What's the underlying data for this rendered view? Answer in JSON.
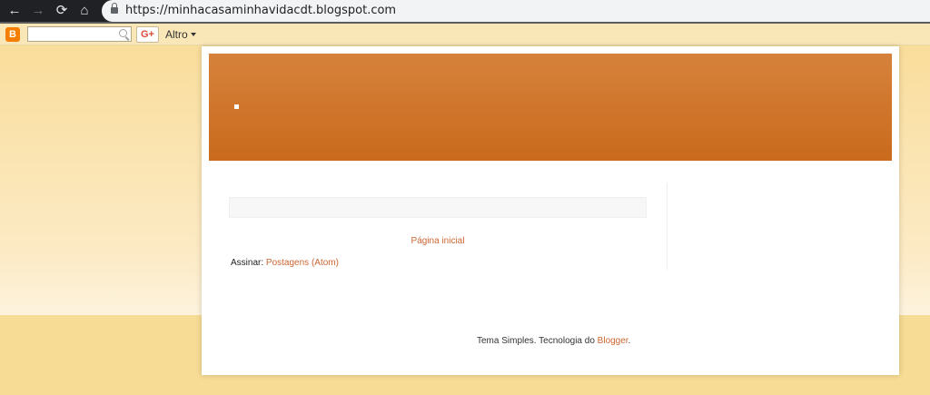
{
  "browser": {
    "back_icon": "←",
    "forward_icon": "→",
    "reload_icon": "⟳",
    "home_icon": "⌂",
    "url": "https://minhacasaminhavidacdt.blogspot.com"
  },
  "navbar": {
    "logo_glyph": "B",
    "gplus_label": "G+",
    "more_label": "Altro"
  },
  "blog": {
    "home_link": "Página inicial",
    "subscribe_label": "Assinar: ",
    "subscribe_link": "Postagens (Atom)",
    "footer_text": "Tema Simples. Tecnologia do ",
    "footer_link": "Blogger",
    "footer_end": "."
  },
  "colors": {
    "header_top": "#d6823c",
    "header_bottom": "#c96a1c",
    "link": "#cc6633",
    "page_bg": "#f6dc94"
  }
}
